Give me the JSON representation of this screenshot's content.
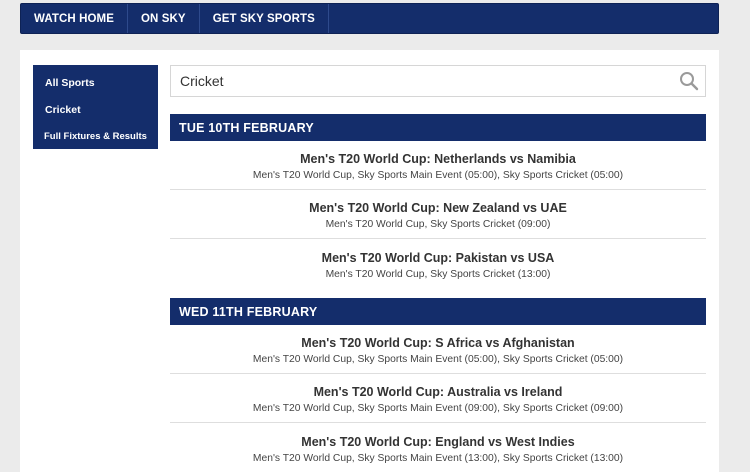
{
  "nav": {
    "items": [
      {
        "label": "WATCH HOME"
      },
      {
        "label": "ON SKY"
      },
      {
        "label": "GET SKY SPORTS"
      }
    ]
  },
  "sidebar": {
    "items": [
      {
        "label": "All Sports"
      },
      {
        "label": "Cricket"
      },
      {
        "label": "Full Fixtures & Results"
      }
    ]
  },
  "search": {
    "value": "Cricket",
    "icon": "magnifier-icon"
  },
  "days": [
    {
      "header": "TUE 10TH FEBRUARY",
      "events": [
        {
          "title": "Men's T20 World Cup: Netherlands vs Namibia",
          "channels": "Men's T20 World Cup, Sky Sports Main Event (05:00), Sky Sports Cricket (05:00)"
        },
        {
          "title": "Men's T20 World Cup: New Zealand vs UAE",
          "channels": "Men's T20 World Cup, Sky Sports Cricket (09:00)"
        },
        {
          "title": "Men's T20 World Cup: Pakistan vs USA",
          "channels": "Men's T20 World Cup, Sky Sports Cricket (13:00)"
        }
      ]
    },
    {
      "header": "WED 11TH FEBRUARY",
      "events": [
        {
          "title": "Men's T20 World Cup: S Africa vs Afghanistan",
          "channels": "Men's T20 World Cup, Sky Sports Main Event (05:00), Sky Sports Cricket (05:00)"
        },
        {
          "title": "Men's T20 World Cup: Australia vs Ireland",
          "channels": "Men's T20 World Cup, Sky Sports Main Event (09:00), Sky Sports Cricket (09:00)"
        },
        {
          "title": "Men's T20 World Cup: England vs West Indies",
          "channels": "Men's T20 World Cup, Sky Sports Main Event (13:00), Sky Sports Cricket (13:00)"
        }
      ]
    }
  ],
  "colors": {
    "navy": "#142d6b",
    "background": "#ebebeb",
    "panel": "#ffffff"
  }
}
